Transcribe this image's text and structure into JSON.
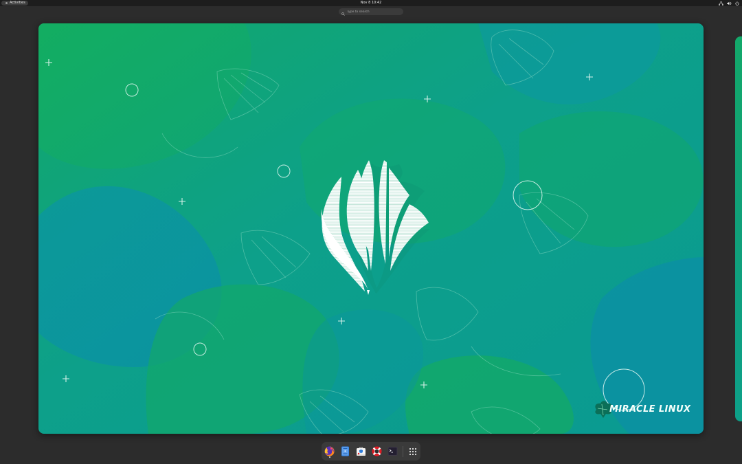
{
  "topbar": {
    "activities_label": "Activities",
    "clock": "Nov 8  10:42",
    "tray": {
      "network_icon": "network-icon",
      "volume_icon": "volume-icon",
      "power_icon": "power-icon"
    }
  },
  "search": {
    "placeholder": "Type to search"
  },
  "wallpaper": {
    "brand_text": "MIRACLE LINUX",
    "colors": {
      "base": "#0f9e8e",
      "green": "#10aa63",
      "teal": "#0b9aa0"
    }
  },
  "dock": {
    "items": [
      {
        "name": "Firefox",
        "icon": "firefox-icon"
      },
      {
        "name": "Files",
        "icon": "files-icon"
      },
      {
        "name": "Software",
        "icon": "software-icon"
      },
      {
        "name": "Help",
        "icon": "help-icon"
      },
      {
        "name": "Terminal",
        "icon": "terminal-icon"
      },
      {
        "name": "Show Applications",
        "icon": "app-grid-icon"
      }
    ]
  }
}
